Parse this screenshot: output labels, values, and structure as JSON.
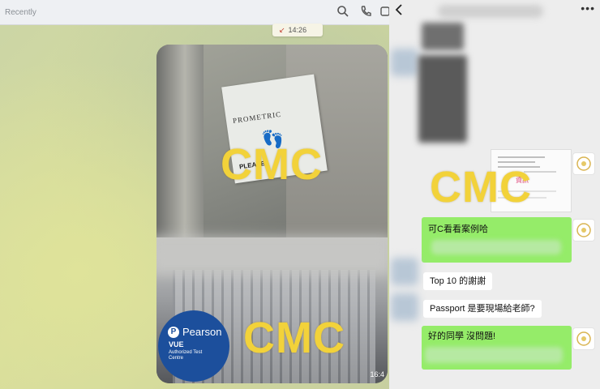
{
  "left_window": {
    "presence_text": "Recently",
    "toolbar_icons": [
      "search-icon",
      "phone-icon",
      "video-icon"
    ],
    "timestamp": "14:26",
    "photo_card": {
      "sign_brand": "PROMETRIC",
      "sign_text": "PLEASE",
      "pearson_brand": "Pearson",
      "pearson_product": "VUE",
      "pearson_subtitle": "Authorized Test Centre",
      "photo_time": "16:4"
    }
  },
  "watermark": "CMC",
  "mobile_chat": {
    "header_icons": [
      "back-icon",
      "more-icon"
    ],
    "document_thumb_text": "資訊",
    "messages": [
      {
        "side": "right",
        "type": "text",
        "text": "可C看看案例哈"
      },
      {
        "side": "left",
        "type": "text",
        "text": "Top 10 的謝謝"
      },
      {
        "side": "left",
        "type": "text",
        "text": "Passport 是要現場給老師?"
      },
      {
        "side": "right",
        "type": "text",
        "text": "好的同學 沒問題!"
      }
    ]
  },
  "colors": {
    "watermark": "#f2d23a",
    "bubble_green": "#95ec69",
    "chat_bg": "#ededed",
    "pearson_blue": "#1c4f9c"
  }
}
